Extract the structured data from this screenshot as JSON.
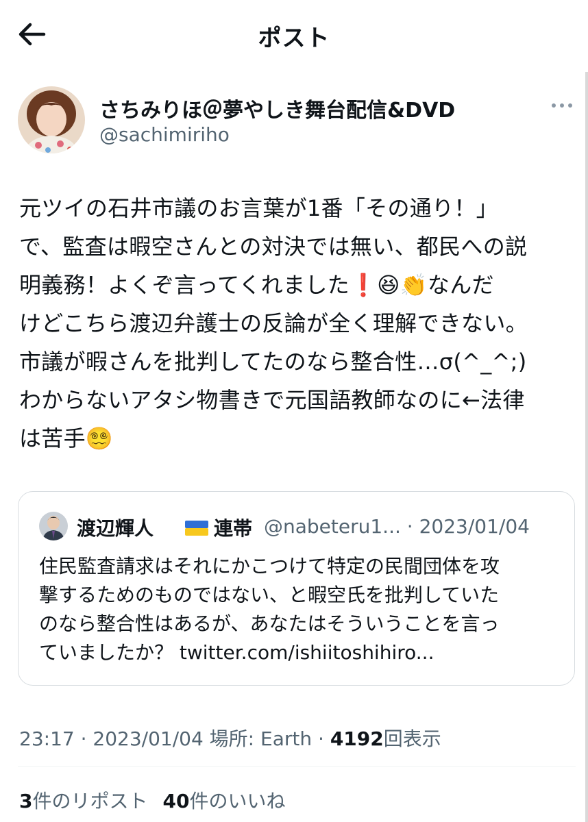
{
  "header": {
    "title": "ポスト"
  },
  "author": {
    "display_name": "さちみりほ＠夢やしき舞台配信&DVD",
    "handle": "@sachimiriho"
  },
  "post": {
    "lines": [
      "元ツイの石井市議のお言葉が1番「その通り！」",
      "で、監査は暇空さんとの対決では無い、都民への説",
      "明義務！よくぞ言ってくれました❗️😆👏なんだ",
      "けどこちら渡辺弁護士の反論が全く理解できない。",
      "市議が暇さんを批判してたのなら整合性…σ(^_^;)",
      "わからないアタシ物書きで元国語教師なのに←法律",
      "は苦手😵‍💫"
    ]
  },
  "quote": {
    "name": "渡辺輝人",
    "name_suffix": "連帯",
    "handle": "@nabeteru1...",
    "date": "· 2023/01/04",
    "lines": [
      "住民監査請求はそれにかこつけて特定の民間団体を攻",
      "撃するためのものではない、と暇空氏を批判していた",
      "のなら整合性はあるが、あなたはそういうことを言っ",
      "ていましたか？ twitter.com/ishiitoshihiro..."
    ]
  },
  "meta": {
    "time_date_place": "23:17 · 2023/01/04 場所: Earth ·",
    "views_count": "4192",
    "views_label": "回表示"
  },
  "stats": {
    "reposts_count": "3",
    "reposts_label": "件のリポスト",
    "likes_count": "40",
    "likes_label": "件のいいね"
  },
  "colors": {
    "text": "#0f1419",
    "secondary": "#536471",
    "border": "#d7dce0"
  },
  "icons": {
    "back": "arrow-left-icon",
    "more": "more-horizontal-icon",
    "flag": "ukraine-flag-icon"
  }
}
